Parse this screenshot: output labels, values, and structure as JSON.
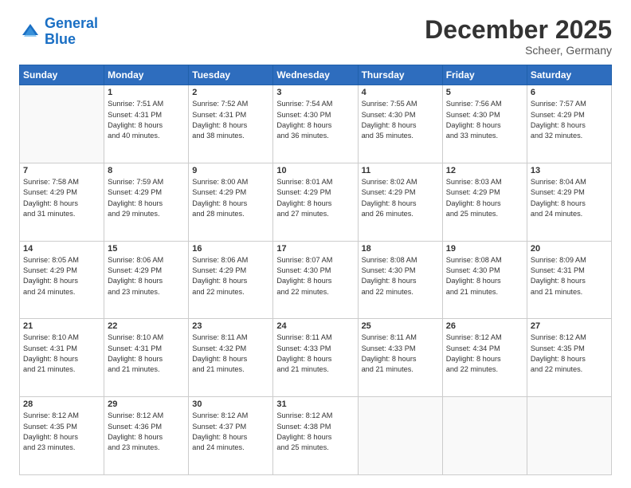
{
  "header": {
    "logo_line1": "General",
    "logo_line2": "Blue",
    "month": "December 2025",
    "location": "Scheer, Germany"
  },
  "weekdays": [
    "Sunday",
    "Monday",
    "Tuesday",
    "Wednesday",
    "Thursday",
    "Friday",
    "Saturday"
  ],
  "weeks": [
    [
      {
        "day": "",
        "info": ""
      },
      {
        "day": "1",
        "info": "Sunrise: 7:51 AM\nSunset: 4:31 PM\nDaylight: 8 hours\nand 40 minutes."
      },
      {
        "day": "2",
        "info": "Sunrise: 7:52 AM\nSunset: 4:31 PM\nDaylight: 8 hours\nand 38 minutes."
      },
      {
        "day": "3",
        "info": "Sunrise: 7:54 AM\nSunset: 4:30 PM\nDaylight: 8 hours\nand 36 minutes."
      },
      {
        "day": "4",
        "info": "Sunrise: 7:55 AM\nSunset: 4:30 PM\nDaylight: 8 hours\nand 35 minutes."
      },
      {
        "day": "5",
        "info": "Sunrise: 7:56 AM\nSunset: 4:30 PM\nDaylight: 8 hours\nand 33 minutes."
      },
      {
        "day": "6",
        "info": "Sunrise: 7:57 AM\nSunset: 4:29 PM\nDaylight: 8 hours\nand 32 minutes."
      }
    ],
    [
      {
        "day": "7",
        "info": "Sunrise: 7:58 AM\nSunset: 4:29 PM\nDaylight: 8 hours\nand 31 minutes."
      },
      {
        "day": "8",
        "info": "Sunrise: 7:59 AM\nSunset: 4:29 PM\nDaylight: 8 hours\nand 29 minutes."
      },
      {
        "day": "9",
        "info": "Sunrise: 8:00 AM\nSunset: 4:29 PM\nDaylight: 8 hours\nand 28 minutes."
      },
      {
        "day": "10",
        "info": "Sunrise: 8:01 AM\nSunset: 4:29 PM\nDaylight: 8 hours\nand 27 minutes."
      },
      {
        "day": "11",
        "info": "Sunrise: 8:02 AM\nSunset: 4:29 PM\nDaylight: 8 hours\nand 26 minutes."
      },
      {
        "day": "12",
        "info": "Sunrise: 8:03 AM\nSunset: 4:29 PM\nDaylight: 8 hours\nand 25 minutes."
      },
      {
        "day": "13",
        "info": "Sunrise: 8:04 AM\nSunset: 4:29 PM\nDaylight: 8 hours\nand 24 minutes."
      }
    ],
    [
      {
        "day": "14",
        "info": "Sunrise: 8:05 AM\nSunset: 4:29 PM\nDaylight: 8 hours\nand 24 minutes."
      },
      {
        "day": "15",
        "info": "Sunrise: 8:06 AM\nSunset: 4:29 PM\nDaylight: 8 hours\nand 23 minutes."
      },
      {
        "day": "16",
        "info": "Sunrise: 8:06 AM\nSunset: 4:29 PM\nDaylight: 8 hours\nand 22 minutes."
      },
      {
        "day": "17",
        "info": "Sunrise: 8:07 AM\nSunset: 4:30 PM\nDaylight: 8 hours\nand 22 minutes."
      },
      {
        "day": "18",
        "info": "Sunrise: 8:08 AM\nSunset: 4:30 PM\nDaylight: 8 hours\nand 22 minutes."
      },
      {
        "day": "19",
        "info": "Sunrise: 8:08 AM\nSunset: 4:30 PM\nDaylight: 8 hours\nand 21 minutes."
      },
      {
        "day": "20",
        "info": "Sunrise: 8:09 AM\nSunset: 4:31 PM\nDaylight: 8 hours\nand 21 minutes."
      }
    ],
    [
      {
        "day": "21",
        "info": "Sunrise: 8:10 AM\nSunset: 4:31 PM\nDaylight: 8 hours\nand 21 minutes."
      },
      {
        "day": "22",
        "info": "Sunrise: 8:10 AM\nSunset: 4:31 PM\nDaylight: 8 hours\nand 21 minutes."
      },
      {
        "day": "23",
        "info": "Sunrise: 8:11 AM\nSunset: 4:32 PM\nDaylight: 8 hours\nand 21 minutes."
      },
      {
        "day": "24",
        "info": "Sunrise: 8:11 AM\nSunset: 4:33 PM\nDaylight: 8 hours\nand 21 minutes."
      },
      {
        "day": "25",
        "info": "Sunrise: 8:11 AM\nSunset: 4:33 PM\nDaylight: 8 hours\nand 21 minutes."
      },
      {
        "day": "26",
        "info": "Sunrise: 8:12 AM\nSunset: 4:34 PM\nDaylight: 8 hours\nand 22 minutes."
      },
      {
        "day": "27",
        "info": "Sunrise: 8:12 AM\nSunset: 4:35 PM\nDaylight: 8 hours\nand 22 minutes."
      }
    ],
    [
      {
        "day": "28",
        "info": "Sunrise: 8:12 AM\nSunset: 4:35 PM\nDaylight: 8 hours\nand 23 minutes."
      },
      {
        "day": "29",
        "info": "Sunrise: 8:12 AM\nSunset: 4:36 PM\nDaylight: 8 hours\nand 23 minutes."
      },
      {
        "day": "30",
        "info": "Sunrise: 8:12 AM\nSunset: 4:37 PM\nDaylight: 8 hours\nand 24 minutes."
      },
      {
        "day": "31",
        "info": "Sunrise: 8:12 AM\nSunset: 4:38 PM\nDaylight: 8 hours\nand 25 minutes."
      },
      {
        "day": "",
        "info": ""
      },
      {
        "day": "",
        "info": ""
      },
      {
        "day": "",
        "info": ""
      }
    ]
  ]
}
